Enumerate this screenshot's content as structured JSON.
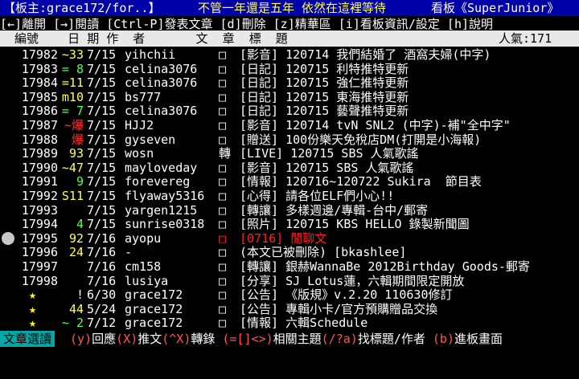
{
  "header": {
    "moderator": "【板主:grace172/for..】",
    "slogan": "不管一年還是五年 依然在這裡等待",
    "board": "看板《SuperJunior》"
  },
  "menu": "[←]離開 [→]閱讀 [Ctrl-P]發表文章 [d]刪除 [z]精華區 [i]看板資訊/設定 [h]說明",
  "column_header": {
    "label": "  編號    日 期 作  者       文  章  標  題",
    "popularity": "人氣:171"
  },
  "articles": [
    {
      "num": "17982",
      "mark": "~33",
      "mark_color": "#ffff55",
      "date": "7/15",
      "author": "yihchii",
      "box": "□",
      "title": "[影音] 120714 我們結婚了 酒窩夫婦(中字)"
    },
    {
      "num": "17983",
      "mark": "= 8",
      "mark_color": "#55ff55",
      "date": "7/15",
      "author": "celina3076",
      "box": "□",
      "title": "[日記] 120715 利特推特更新"
    },
    {
      "num": "17984",
      "mark": "=11",
      "mark_color": "#ffff55",
      "date": "7/15",
      "author": "celina3076",
      "box": "□",
      "title": "[日記] 120715 強仁推特更新"
    },
    {
      "num": "17985",
      "mark": "m10",
      "mark_color": "#ffff55",
      "date": "7/15",
      "author": "bs777",
      "box": "□",
      "title": "[日記] 120715 東海推特更新"
    },
    {
      "num": "17986",
      "mark": "= 7",
      "mark_color": "#55ff55",
      "date": "7/15",
      "author": "celina3076",
      "box": "□",
      "title": "[日記] 120715 藝聲推特更新"
    },
    {
      "num": "17987",
      "mark": "~爆",
      "mark_color": "#ff3030",
      "date": "7/15",
      "author": "HJJ2",
      "box": "□",
      "title": "[影音] 120714 tvN SNL2 (中字)-補\"全中字\""
    },
    {
      "num": "17988",
      "mark": "爆",
      "mark_color": "#ff3030",
      "date": "7/15",
      "author": "gyseven",
      "box": "□",
      "title": "[贈送] 100份樂天免稅店DM(打開是小海報)"
    },
    {
      "num": "17989",
      "mark": "93",
      "mark_color": "#ffff55",
      "date": "7/15",
      "author": "wosn",
      "box": "轉",
      "title": "[LIVE] 120715 SBS 人氣歌謠"
    },
    {
      "num": "17990",
      "mark": "~47",
      "mark_color": "#ffff55",
      "date": "7/15",
      "author": "mayloveday",
      "box": "□",
      "title": "[影音] 120715 SBS 人氣歌謠"
    },
    {
      "num": "17991",
      "mark": "9",
      "mark_color": "#55ff55",
      "date": "7/15",
      "author": "forevereg",
      "box": "□",
      "title": "[情報] 120716~120722 Sukira  節目表"
    },
    {
      "num": "17992",
      "mark": "S11",
      "mark_color": "#ffff55",
      "date": "7/15",
      "author": "flyaway5316",
      "box": "□",
      "title": "[心得] 請各位ELF們小心!!"
    },
    {
      "num": "17993",
      "mark": "",
      "mark_color": "#ffffff",
      "date": "7/15",
      "author": "yargen1215",
      "box": "□",
      "title": "[轉讓] 多樣週邊/專輯-台中/郵寄"
    },
    {
      "num": "17994",
      "mark": "4",
      "mark_color": "#55ff55",
      "date": "7/15",
      "author": "sunrise0318",
      "box": "□",
      "title": "[照片] 120715 KBS HELLO 錄製新聞圖"
    },
    {
      "num": "17995",
      "mark": "92",
      "mark_color": "#ffff55",
      "date": "7/16",
      "author": "ayopu",
      "box": "□",
      "title": "[0716] 閒聊文",
      "selected": true
    },
    {
      "num": "17996",
      "mark": "24",
      "mark_color": "#ffff55",
      "date": "7/16",
      "author": "-",
      "box": "□",
      "title": "(本文已被刪除) [bkashlee]"
    },
    {
      "num": "17997",
      "mark": "",
      "mark_color": "#ffffff",
      "date": "7/16",
      "author": "cm158",
      "box": "□",
      "title": "[轉讓] 銀赫WannaBe 2012Birthday Goods-郵寄"
    },
    {
      "num": "17998",
      "mark": "",
      "mark_color": "#ffffff",
      "date": "7/16",
      "author": "lusiya",
      "box": "□",
      "title": "[分享] SJ Lotus蓮，六輯期間限定開放"
    },
    {
      "num": "★",
      "mark": "!",
      "mark_color": "#ffffff",
      "date": "6/30",
      "author": "grace172",
      "box": "□",
      "title": "[公告] 《版規》v.2.20 110630修訂"
    },
    {
      "num": "★",
      "mark": "44",
      "mark_color": "#ffff55",
      "date": "5/24",
      "author": "grace172",
      "box": "□",
      "title": "[公告] 專輯小卡/官方預購贈品交換"
    },
    {
      "num": "★",
      "mark": "~ 2",
      "mark_color": "#55ff55",
      "date": "7/12",
      "author": "grace172",
      "box": "□",
      "title": "[情報] 六輯Schedule"
    }
  ],
  "footer": {
    "mode": "文章選讀",
    "keys": [
      {
        "k": " (y)",
        "t": "回應"
      },
      {
        "k": "(X)",
        "t": "推文"
      },
      {
        "k": "(^X)",
        "t": "轉錄"
      },
      {
        "k": " (=[]<>)",
        "t": "相關主題"
      },
      {
        "k": "(/?a)",
        "t": "找標題/作者"
      },
      {
        "k": " (b)",
        "t": "進板畫面"
      }
    ]
  },
  "colors": {
    "header_bg": "#0000a8",
    "footer_tab": "#00a8a8",
    "selected_title": "#ff2020"
  }
}
